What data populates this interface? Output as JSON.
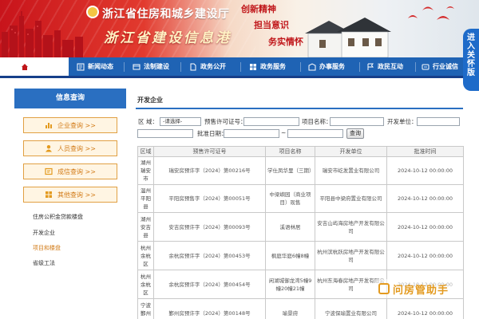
{
  "header": {
    "site_name": "浙江省住房和城乡建设厅",
    "site_subtitle": "浙江省建设信息港",
    "slogans": [
      "创新精神",
      "担当意识",
      "务实情怀"
    ]
  },
  "side_flag": [
    "进",
    "入",
    "关",
    "怀",
    "版"
  ],
  "nav": {
    "items": [
      {
        "label": "首页",
        "icon": "home-icon"
      },
      {
        "label": "新闻动态",
        "icon": "news-icon"
      },
      {
        "label": "法制建设",
        "icon": "law-icon"
      },
      {
        "label": "政务公开",
        "icon": "doc-icon"
      },
      {
        "label": "政务服务",
        "icon": "service-icon"
      },
      {
        "label": "办事服务",
        "icon": "building-icon"
      },
      {
        "label": "政民互动",
        "icon": "flag-icon"
      },
      {
        "label": "行业诚信",
        "icon": "credit-icon"
      }
    ]
  },
  "sidebar": {
    "title": "信息查询",
    "buttons": [
      {
        "label": "企业查询 >>",
        "icon": "chart-icon"
      },
      {
        "label": "人员查询 >>",
        "icon": "person-icon"
      },
      {
        "label": "成信查询 >>",
        "icon": "certificate-icon"
      },
      {
        "label": "其他查询 >>",
        "icon": "grid-icon"
      }
    ],
    "links": [
      "住房公积金贷款楼盘",
      "开发企业",
      "项目和楼盘",
      "省级工法"
    ],
    "active_link": "项目和楼盘"
  },
  "main": {
    "title": "开发企业",
    "filters": {
      "region_label": "区   域：",
      "region_value": "-请选择-",
      "permit_label": "预售许可证号：",
      "project_label": "项目名称：",
      "developer_label": "开发单位：",
      "approval_label": "批准日期：",
      "date_sep": "~",
      "search_button": "查询"
    },
    "table": {
      "columns": [
        "区域",
        "预售许可证号",
        "项目名称",
        "开发单位",
        "批准时间"
      ],
      "rows": [
        [
          "湖州瑞安市",
          "瑞安房预许字（2024）第00216号",
          "学仕凤华里（三期）",
          "瑞安市屹发置业有限公司",
          "2024-10-12 00:00:00"
        ],
        [
          "温州平阳县",
          "平阳房预售字（2024）第00051号",
          "中梁嶼园（商业项目）现售",
          "平阳县中梁府置业有限公司",
          "2024-10-12 00:00:00"
        ],
        [
          "湖州安吉县",
          "安吉房预许字（2024）第00093号",
          "溪语林居",
          "安吉山屿海房地产开发有限公司",
          "2024-10-12 00:00:00"
        ],
        [
          "杭州余杭区",
          "余杭房预许字（2024）第00453号",
          "枫庭华庭6幢8幢",
          "杭州滨杭跃房地产开发有限公司",
          "2024-10-12 00:00:00"
        ],
        [
          "杭州余杭区",
          "余杭房预许字（2024）第00454号",
          "闲湖城御龙湾5幢9幢20幢21幢",
          "杭州东海春房地产开发有限公司",
          "2024-10-12 00:00:00"
        ],
        [
          "宁波鄞州区",
          "鄞州房预许字（2024）第00148号",
          "瑜景府",
          "宁波保瑜置业有限公司",
          "2024-10-12 00:00:00"
        ]
      ]
    }
  },
  "watermark": "问房管助手",
  "colors": {
    "brand_red": "#c8141b",
    "nav_blue": "#1f63b4",
    "accent_orange": "#d27b17"
  }
}
